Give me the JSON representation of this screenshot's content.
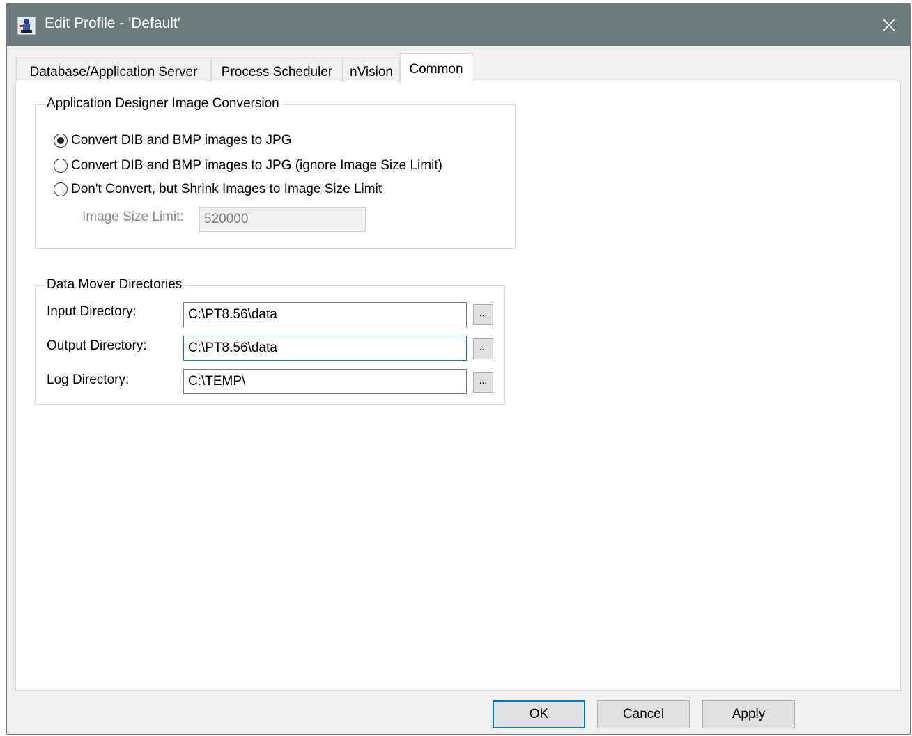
{
  "window": {
    "title": "Edit Profile - 'Default'",
    "close_glyph": "✕"
  },
  "tabs": [
    {
      "label": "Database/Application Server",
      "active": false
    },
    {
      "label": "Process Scheduler",
      "active": false
    },
    {
      "label": "nVision",
      "active": false
    },
    {
      "label": "Common",
      "active": true
    }
  ],
  "image_conversion": {
    "title": "Application Designer Image Conversion",
    "options": [
      {
        "label": "Convert DIB and BMP images to JPG",
        "selected": true
      },
      {
        "label": "Convert DIB and BMP images to JPG (ignore Image Size Limit)",
        "selected": false
      },
      {
        "label": "Don't Convert, but Shrink Images to Image Size Limit",
        "selected": false
      }
    ],
    "size_limit_label": "Image Size Limit:",
    "size_limit_value": "520000"
  },
  "data_mover": {
    "title": "Data Mover Directories",
    "input_label": "Input Directory:",
    "input_value": "C:\\PT8.56\\data",
    "output_label": "Output Directory:",
    "output_value": "C:\\PT8.56\\data",
    "log_label": "Log Directory:",
    "log_value": "C:\\TEMP\\",
    "browse_label": "..."
  },
  "buttons": {
    "ok": "OK",
    "cancel": "Cancel",
    "apply": "Apply"
  },
  "colors": {
    "titlebar": "#6b7b7b",
    "focus_accent": "#0078d7"
  }
}
